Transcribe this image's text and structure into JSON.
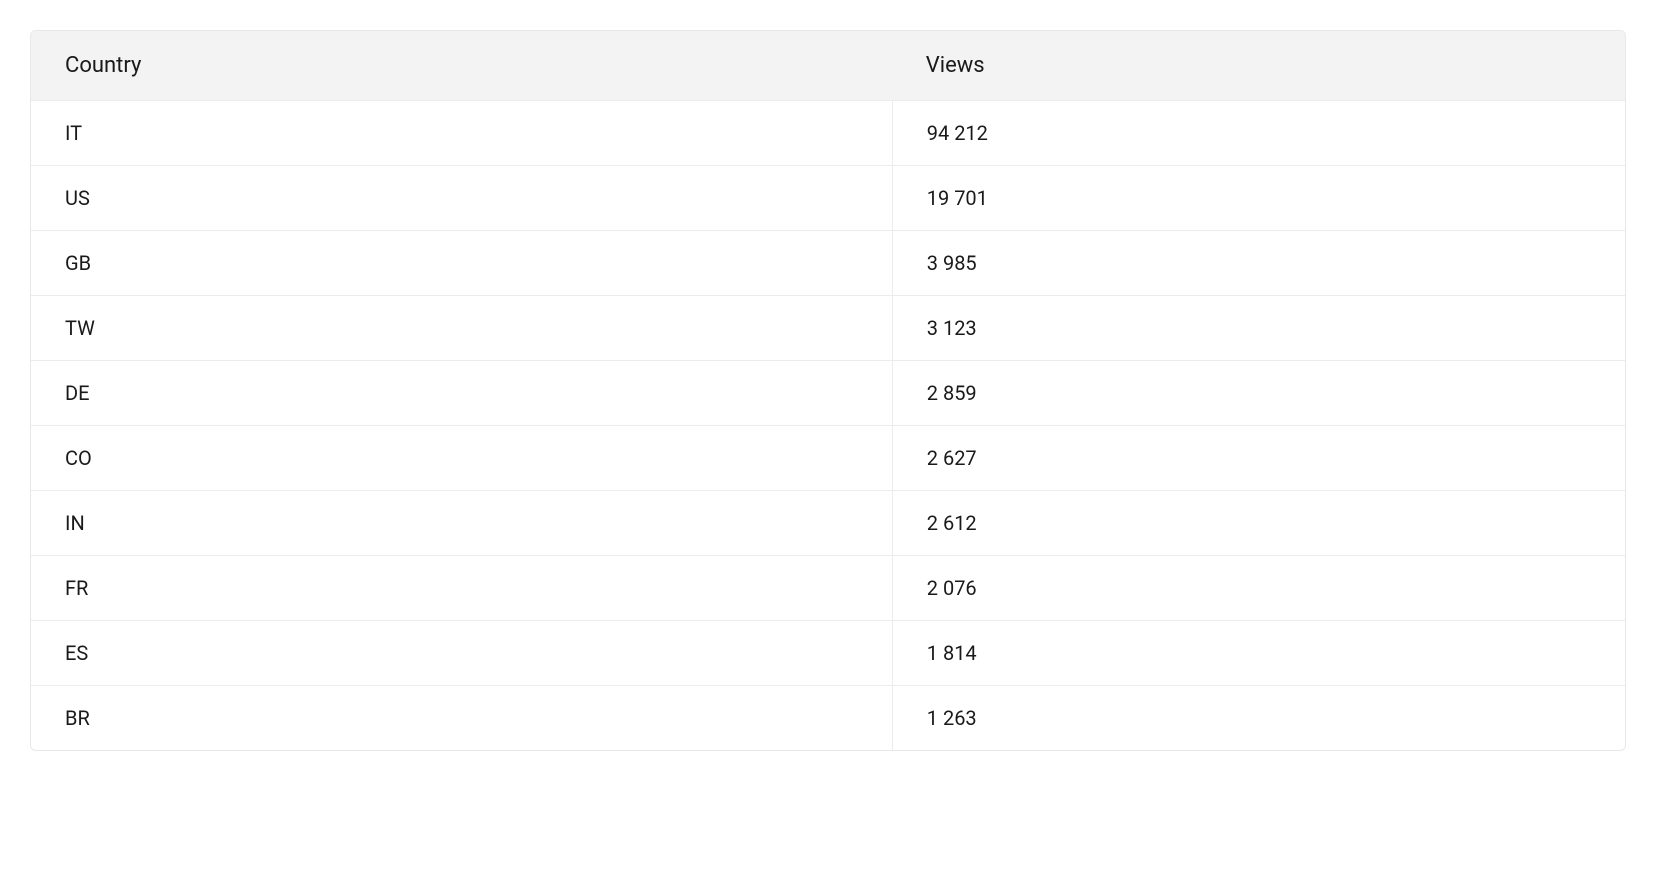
{
  "table": {
    "headers": {
      "country": "Country",
      "views": "Views"
    },
    "rows": [
      {
        "country": "IT",
        "views": "94 212"
      },
      {
        "country": "US",
        "views": "19 701"
      },
      {
        "country": "GB",
        "views": "3 985"
      },
      {
        "country": "TW",
        "views": "3 123"
      },
      {
        "country": "DE",
        "views": "2 859"
      },
      {
        "country": "CO",
        "views": "2 627"
      },
      {
        "country": "IN",
        "views": "2 612"
      },
      {
        "country": "FR",
        "views": "2 076"
      },
      {
        "country": "ES",
        "views": "1 814"
      },
      {
        "country": "BR",
        "views": "1 263"
      }
    ]
  }
}
